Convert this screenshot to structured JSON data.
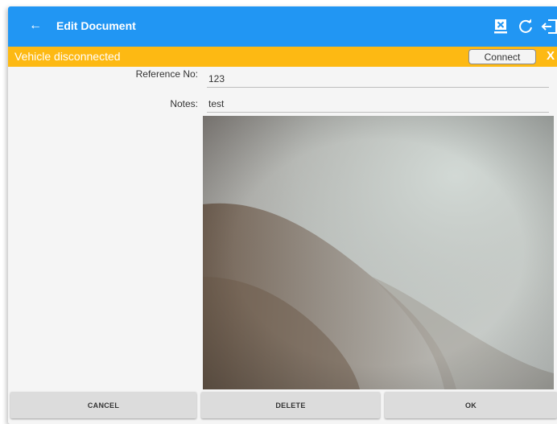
{
  "appbar": {
    "title": "Edit Document",
    "back_icon": "arrow-left-icon",
    "actions": [
      {
        "icon": "document-remove-icon"
      },
      {
        "icon": "refresh-icon"
      },
      {
        "icon": "logout-icon"
      }
    ],
    "color": "#2196f3"
  },
  "status": {
    "message": "Vehicle disconnected",
    "connect_label": "Connect",
    "dismiss_label": "X",
    "color": "#fdb913"
  },
  "form": {
    "reference_label": "Reference No:",
    "reference_value": "123",
    "notes_label": "Notes:",
    "notes_value": "test"
  },
  "buttons": {
    "cancel": "CANCEL",
    "delete": "DELETE",
    "ok": "OK"
  }
}
